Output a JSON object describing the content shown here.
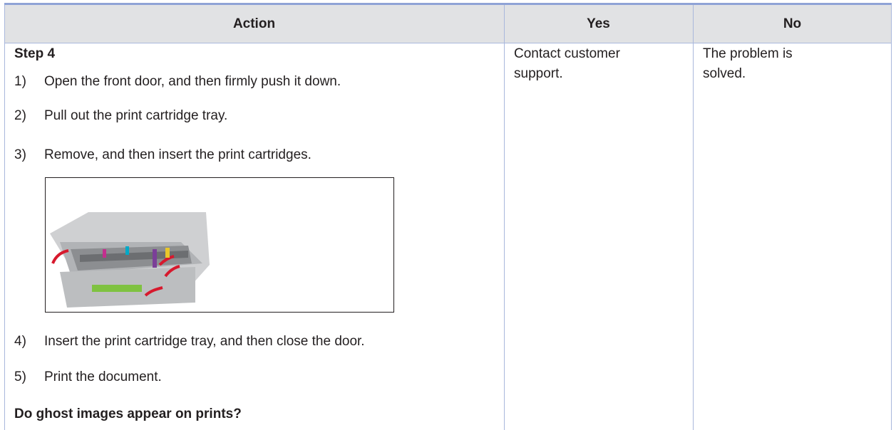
{
  "header": {
    "action": "Action",
    "yes": "Yes",
    "no": "No"
  },
  "step": {
    "title": "Step 4",
    "items": [
      {
        "num": "1)",
        "text": "Open the front door, and then firmly push it down."
      },
      {
        "num": "2)",
        "text": "Pull out the print cartridge tray."
      },
      {
        "num": "3)",
        "text": "Remove, and then insert the print cartridges."
      },
      {
        "num": "4)",
        "text": "Insert the print cartridge tray, and then close the door."
      },
      {
        "num": "5)",
        "text": "Print the document."
      }
    ],
    "question": "Do ghost images appear on prints?"
  },
  "yes_text": {
    "line1": "Contact customer",
    "line2": "support."
  },
  "no_text": {
    "line1": "The problem is",
    "line2": "solved."
  },
  "colors": {
    "header_bg": "#e1e2e4",
    "rule": "#a9b8dc",
    "arrow_red": "#d7192d",
    "tray_green": "#7fc241"
  }
}
